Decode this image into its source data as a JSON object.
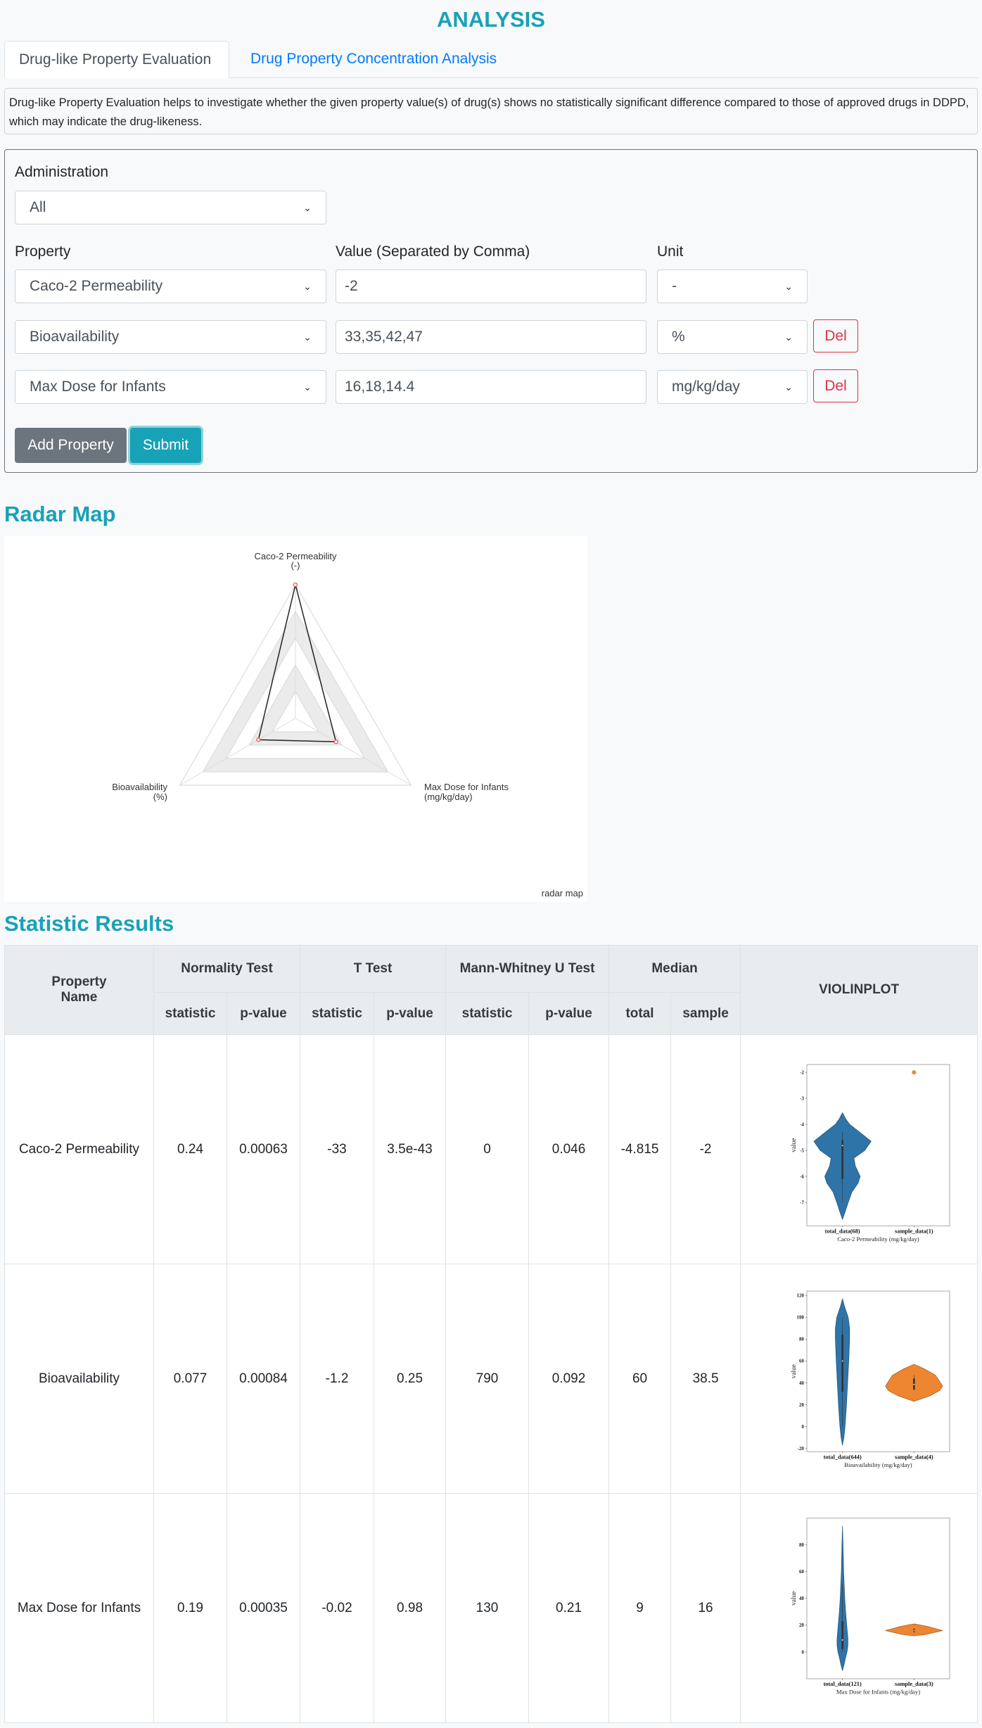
{
  "header": {
    "title": "ANALYSIS"
  },
  "tabs": [
    {
      "label": "Drug-like Property Evaluation",
      "active": true
    },
    {
      "label": "Drug Property Concentration Analysis",
      "active": false
    }
  ],
  "description": "Drug-like Property Evaluation helps to investigate whether the given property value(s) of drug(s) shows no statistically significant difference compared to those of approved drugs in DDPD, which may indicate the drug-likeness.",
  "form": {
    "administration_label": "Administration",
    "administration_value": "All",
    "property_label": "Property",
    "value_label": "Value (Separated by Comma)",
    "unit_label": "Unit",
    "rows": [
      {
        "property": "Caco-2 Permeability",
        "value": "-2",
        "unit": "-"
      },
      {
        "property": "Bioavailability",
        "value": "33,35,42,47",
        "unit": "%",
        "del": "Del"
      },
      {
        "property": "Max Dose for Infants",
        "value": "16,18,14.4",
        "unit": "mg/kg/day",
        "del": "Del"
      }
    ],
    "add_label": "Add Property",
    "submit_label": "Submit"
  },
  "radar": {
    "heading": "Radar Map"
  },
  "stats": {
    "heading": "Statistic Results",
    "headers": {
      "property": "Property",
      "property2": "Name",
      "normality": "Normality Test",
      "ttest": "T Test",
      "mwu": "Mann-Whitney U Test",
      "median": "Median",
      "violin": "VIOLINPLOT",
      "statistic": "statistic",
      "pvalue": "p-value",
      "total": "total",
      "sample": "sample"
    },
    "rows": [
      {
        "name": "Caco-2 Permeability",
        "norm_stat": "0.24",
        "norm_p": "0.00063",
        "t_stat": "-33",
        "t_p": "3.5e-43",
        "mw_stat": "0",
        "mw_p": "0.046",
        "med_total": "-4.815",
        "med_sample": "-2"
      },
      {
        "name": "Bioavailability",
        "norm_stat": "0.077",
        "norm_p": "0.00084",
        "t_stat": "-1.2",
        "t_p": "0.25",
        "mw_stat": "790",
        "mw_p": "0.092",
        "med_total": "60",
        "med_sample": "38.5"
      },
      {
        "name": "Max Dose for Infants",
        "norm_stat": "0.19",
        "norm_p": "0.00035",
        "t_stat": "-0.02",
        "t_p": "0.98",
        "mw_stat": "130",
        "mw_p": "0.21",
        "med_total": "9",
        "med_sample": "16"
      }
    ]
  },
  "colors": {
    "accent": "#17a2b8",
    "link": "#007bff",
    "danger": "#dc3545",
    "secondary": "#6c757d",
    "total": "#2f74a8",
    "sample": "#ee8530"
  },
  "chart_data": [
    {
      "type": "radar",
      "caption": "radar map",
      "rings": 5,
      "axes": [
        {
          "label": "Caco-2 Permeability",
          "unit": "(-)"
        },
        {
          "label": "Max Dose for Infants",
          "unit": "(mg/kg/day)"
        },
        {
          "label": "Bioavailability",
          "unit": "(%)"
        }
      ],
      "values": [
        1.0,
        0.35,
        0.32
      ]
    },
    {
      "type": "violin",
      "ylabel": "value",
      "xlabel": "Caco-2 Permeability (mg/kg/day)",
      "ylim": [
        -7.9,
        -1.7
      ],
      "yticks": [
        -2,
        -3,
        -4,
        -5,
        -6,
        -7
      ],
      "categories": [
        "total_data(68)",
        "sample_data(1)"
      ],
      "series": [
        {
          "profile": [
            [
              -3.55,
              0
            ],
            [
              -3.8,
              0.12
            ],
            [
              -4.0,
              0.25
            ],
            [
              -4.3,
              0.6
            ],
            [
              -4.65,
              1
            ],
            [
              -5.0,
              0.78
            ],
            [
              -5.3,
              0.4
            ],
            [
              -5.6,
              0.45
            ],
            [
              -6.0,
              0.62
            ],
            [
              -6.25,
              0.55
            ],
            [
              -6.6,
              0.33
            ],
            [
              -7.0,
              0.2
            ],
            [
              -7.4,
              0.08
            ],
            [
              -7.65,
              0
            ]
          ],
          "q": [
            -6.1,
            -4.6
          ],
          "w": [
            -7.0,
            -4.3
          ],
          "median": -4.815
        },
        {
          "points": [
            -2
          ]
        }
      ]
    },
    {
      "type": "violin",
      "ylabel": "value",
      "xlabel": "Bioavailability (mg/kg/day)",
      "ylim": [
        -23,
        124
      ],
      "yticks": [
        120,
        100,
        80,
        60,
        40,
        20,
        0,
        -20
      ],
      "categories": [
        "total_data(644)",
        "sample_data(4)"
      ],
      "series": [
        {
          "profile": [
            [
              117,
              0
            ],
            [
              110,
              0.07
            ],
            [
              100,
              0.2
            ],
            [
              90,
              0.25
            ],
            [
              80,
              0.25
            ],
            [
              60,
              0.22
            ],
            [
              40,
              0.18
            ],
            [
              20,
              0.14
            ],
            [
              0,
              0.09
            ],
            [
              -10,
              0.05
            ],
            [
              -17,
              0
            ]
          ],
          "q": [
            32,
            84
          ],
          "w": [
            0,
            100
          ],
          "median": 60
        },
        {
          "profile": [
            [
              57,
              0
            ],
            [
              53,
              0.35
            ],
            [
              47,
              0.75
            ],
            [
              42,
              0.88
            ],
            [
              37,
              1
            ],
            [
              33,
              0.9
            ],
            [
              28,
              0.55
            ],
            [
              24,
              0.1
            ],
            [
              23,
              0
            ]
          ],
          "q": [
            34,
            44
          ],
          "w": [
            33,
            47
          ],
          "median": 38.5
        }
      ]
    },
    {
      "type": "violin",
      "ylabel": "value",
      "xlabel": "Max Dose for Infants (mg/kg/day)",
      "ylim": [
        -20,
        100
      ],
      "yticks": [
        80,
        60,
        40,
        20,
        0
      ],
      "categories": [
        "total_data(121)",
        "sample_data(3)"
      ],
      "series": [
        {
          "profile": [
            [
              94,
              0
            ],
            [
              80,
              0.02
            ],
            [
              60,
              0.04
            ],
            [
              50,
              0.06
            ],
            [
              40,
              0.08
            ],
            [
              30,
              0.11
            ],
            [
              20,
              0.15
            ],
            [
              10,
              0.19
            ],
            [
              5,
              0.19
            ],
            [
              0,
              0.16
            ],
            [
              -5,
              0.1
            ],
            [
              -10,
              0.05
            ],
            [
              -14,
              0
            ]
          ],
          "q": [
            2,
            23
          ],
          "w": [
            0,
            50
          ],
          "median": 9
        },
        {
          "profile": [
            [
              21,
              0
            ],
            [
              19,
              0.5
            ],
            [
              17,
              0.82
            ],
            [
              16,
              1
            ],
            [
              15,
              0.8
            ],
            [
              13,
              0.4
            ],
            [
              12,
              0
            ]
          ],
          "q": [
            15,
            17
          ],
          "w": [
            14.4,
            18
          ],
          "median": 16
        }
      ]
    }
  ]
}
